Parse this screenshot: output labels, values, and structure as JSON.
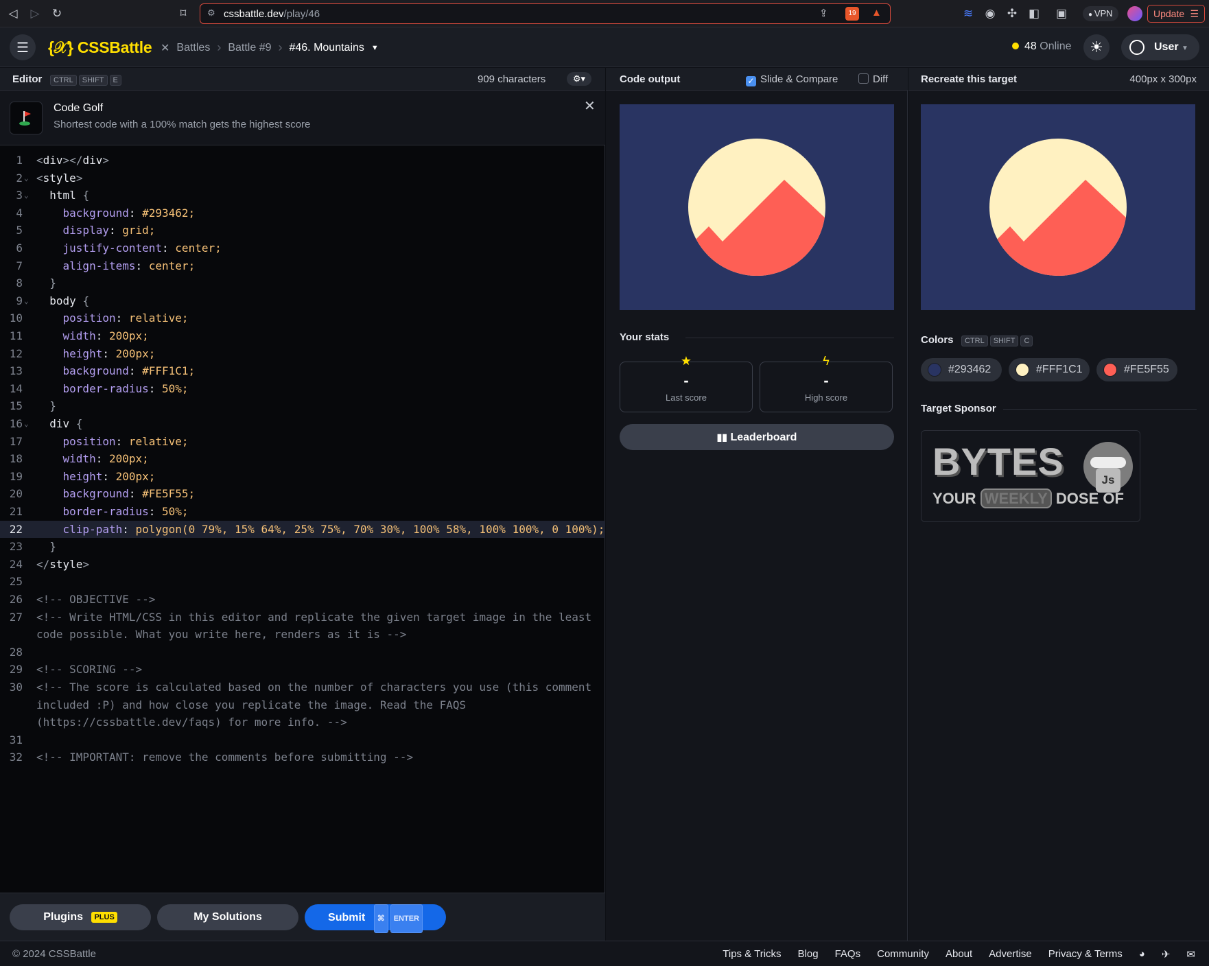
{
  "browser": {
    "url_host": "cssbattle.dev",
    "url_path": "/play/46",
    "shield_count": "19",
    "vpn_label": "VPN",
    "update_label": "Update"
  },
  "header": {
    "logo": "{𝒳} CSSBattle",
    "crumbs": [
      "Battles",
      "Battle #9",
      "#46. Mountains"
    ],
    "online_count": "48",
    "online_label": "Online",
    "user_label": "User"
  },
  "editor": {
    "title": "Editor",
    "shortcut": [
      "CTRL",
      "SHIFT",
      "E"
    ],
    "char_count": "909 characters",
    "golf_title": "Code Golf",
    "golf_desc": "Shortest code with a 100% match gets the highest score",
    "lines": [
      "<div></div>",
      "<style>",
      "  html {",
      "    background: #293462;",
      "    display: grid;",
      "    justify-content: center;",
      "    align-items: center;",
      "  }",
      "  body {",
      "    position: relative;",
      "    width: 200px;",
      "    height: 200px;",
      "    background: #FFF1C1;",
      "    border-radius: 50%;",
      "  }",
      "  div {",
      "    position: relative;",
      "    width: 200px;",
      "    height: 200px;",
      "    background: #FE5F55;",
      "    border-radius: 50%;",
      "    clip-path: polygon(0 79%, 15% 64%, 25% 75%, 70% 30%, 100% 58%, 100% 100%, 0 100%);",
      "  }",
      "</style>",
      "",
      "<!-- OBJECTIVE -->",
      "<!-- Write HTML/CSS in this editor and replicate the given target image in the least",
      "code possible. What you write here, renders as it is -->",
      "",
      "<!-- SCORING -->",
      "<!-- The score is calculated based on the number of characters you use (this comment",
      "included :P) and how close you replicate the image. Read the FAQS",
      "(https://cssbattle.dev/faqs) for more info. -->",
      "",
      "<!-- IMPORTANT: remove the comments before submitting -->"
    ],
    "line_numbers": [
      "1",
      "2",
      "3",
      "4",
      "5",
      "6",
      "7",
      "8",
      "9",
      "10",
      "11",
      "12",
      "13",
      "14",
      "15",
      "16",
      "17",
      "18",
      "19",
      "20",
      "21",
      "22",
      "23",
      "24",
      "25",
      "26",
      "27",
      "",
      "28",
      "29",
      "30",
      "",
      "",
      "31",
      "32"
    ],
    "plugins_label": "Plugins",
    "plugins_badge": "PLUS",
    "solutions_label": "My Solutions",
    "submit_label": "Submit",
    "submit_kbd": [
      "⌘",
      "ENTER"
    ]
  },
  "output": {
    "title": "Code output",
    "slide_label": "Slide & Compare",
    "slide_checked": true,
    "diff_label": "Diff",
    "diff_checked": false,
    "stats_title": "Your stats",
    "last_score_value": "-",
    "last_score_label": "Last score",
    "high_score_value": "-",
    "high_score_label": "High score",
    "leaderboard_label": "Leaderboard"
  },
  "target": {
    "title": "Recreate this target",
    "size": "400px x 300px",
    "colors_title": "Colors",
    "colors_shortcut": [
      "CTRL",
      "SHIFT",
      "C"
    ],
    "colors": [
      "#293462",
      "#FFF1C1",
      "#FE5F55"
    ],
    "sponsor_title": "Target Sponsor",
    "sponsor_name": "BYTES",
    "sponsor_tagline": [
      "YOUR",
      "WEEKLY",
      "DOSE OF"
    ],
    "sponsor_badge": "Js"
  },
  "footer": {
    "copyright": "© 2024 CSSBattle",
    "links": [
      "Tips & Tricks",
      "Blog",
      "FAQs",
      "Community",
      "About",
      "Advertise",
      "Privacy & Terms"
    ]
  }
}
